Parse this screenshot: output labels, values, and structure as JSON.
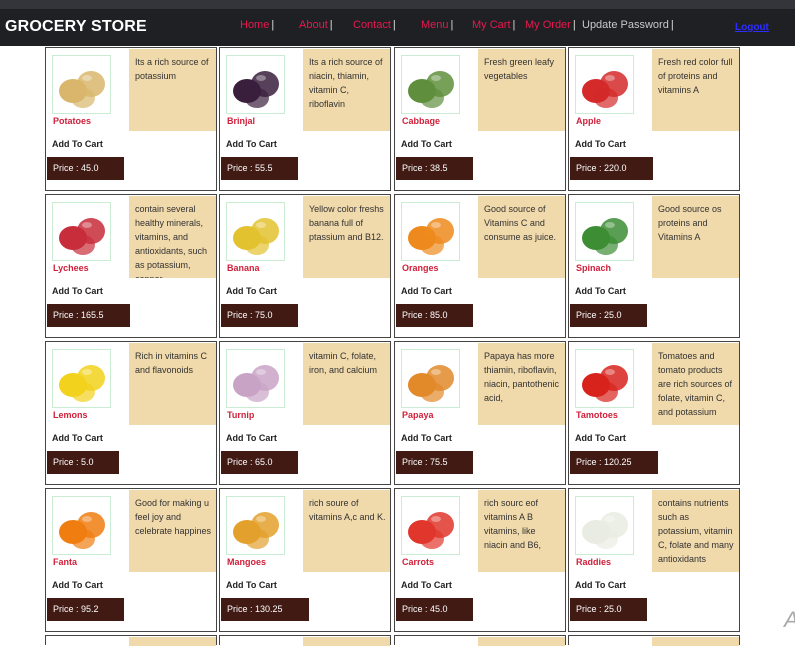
{
  "header": {
    "brand": "GROCERY STORE",
    "nav": [
      {
        "label": "Home"
      },
      {
        "label": "About"
      },
      {
        "label": "Contact"
      },
      {
        "label": "Menu"
      },
      {
        "label": "My Cart"
      },
      {
        "label": "My Order"
      },
      {
        "label": "Update Password"
      }
    ],
    "separator": "|",
    "logout": "Logout"
  },
  "colors": {
    "topbar": "#1f2024",
    "nav_link": "#e8184f",
    "description_bg": "#f0d9aa",
    "price_bg": "#411a14",
    "product_name": "#d0203a"
  },
  "products": [
    {
      "name": "Potatoes",
      "desc": "Its a rich source of potassium",
      "add": "Add To Cart",
      "price": "Price : 45.0",
      "icon": "potato-icon",
      "color": "#d9b66b"
    },
    {
      "name": "Brinjal",
      "desc": "Its a rich source of niacin, thiamin, vitamin C, riboflavin",
      "add": "Add To Cart",
      "price": "Price : 55.5",
      "icon": "eggplant-icon",
      "color": "#3a1f3d"
    },
    {
      "name": "Cabbage",
      "desc": "Fresh green leafy vegetables",
      "add": "Add To Cart",
      "price": "Price : 38.5",
      "icon": "cabbage-icon",
      "color": "#5f8f3c"
    },
    {
      "name": "Apple",
      "desc": "Fresh red color full of proteins and vitamins A",
      "add": "Add To Cart",
      "price": "Price : 220.0",
      "icon": "apple-icon",
      "color": "#d42a2a"
    },
    {
      "name": "Lychees",
      "desc": "contain several healthy minerals, vitamins, and antioxidants, such as potassium, copper",
      "add": "Add To Cart",
      "price": "Price : 165.5",
      "icon": "lychee-icon",
      "color": "#c72d3a"
    },
    {
      "name": "Banana",
      "desc": "Yellow color freshs banana full of ptassium and B12.",
      "add": "Add To Cart",
      "price": "Price : 75.0",
      "icon": "banana-icon",
      "color": "#e3c22f"
    },
    {
      "name": "Oranges",
      "desc": "Good source of Vitamins C and consume as juice.",
      "add": "Add To Cart",
      "price": "Price : 85.0",
      "icon": "orange-icon",
      "color": "#ee8a1d"
    },
    {
      "name": "Spinach",
      "desc": "Good source os proteins and Vitamins A",
      "add": "Add To Cart",
      "price": "Price : 25.0",
      "icon": "spinach-icon",
      "color": "#3c8d34"
    },
    {
      "name": "Lemons",
      "desc": "Rich in vitamins C and flavonoids",
      "add": "Add To Cart",
      "price": "Price : 5.0",
      "icon": "lemon-icon",
      "color": "#f2d21c"
    },
    {
      "name": "Turnip",
      "desc": "vitamin C, folate, iron, and calcium",
      "add": "Add To Cart",
      "price": "Price : 65.0",
      "icon": "turnip-icon",
      "color": "#c9a3c6"
    },
    {
      "name": "Papaya",
      "desc": "Papaya has more thiamin, riboflavin, niacin, pantothenic acid,",
      "add": "Add To Cart",
      "price": "Price : 75.5",
      "icon": "papaya-icon",
      "color": "#e2892a"
    },
    {
      "name": "Tamotoes",
      "desc": "Tomatoes and tomato products are rich sources of folate, vitamin C, and potassium",
      "add": "Add To Cart",
      "price": "Price : 120.25",
      "icon": "tomato-icon",
      "color": "#d8231d"
    },
    {
      "name": "Fanta",
      "desc": "Good for making u feel joy and celebrate happines",
      "add": "Add To Cart",
      "price": "Price : 95.2",
      "icon": "soda-can-icon",
      "color": "#f07d10"
    },
    {
      "name": "Mangoes",
      "desc": "rich soure of vitamins A,c and K.",
      "add": "Add To Cart",
      "price": "Price : 130.25",
      "icon": "mango-icon",
      "color": "#e3a02c"
    },
    {
      "name": "Carrots",
      "desc": "rich sourc eof vitamins A B vitamins, like niacin and B6,",
      "add": "Add To Cart",
      "price": "Price : 45.0",
      "icon": "carrot-icon",
      "color": "#e1362c"
    },
    {
      "name": "Raddies",
      "desc": "contains nutrients such as potassium, vitamin C, folate and many antioxidants",
      "add": "Add To Cart",
      "price": "Price : 25.0",
      "icon": "radish-icon",
      "color": "#e9ece2"
    }
  ]
}
